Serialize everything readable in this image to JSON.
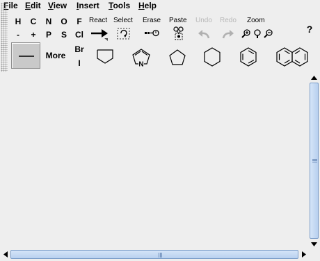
{
  "menu": [
    {
      "mnemonic": "F",
      "rest": "ile"
    },
    {
      "mnemonic": "E",
      "rest": "dit"
    },
    {
      "mnemonic": "V",
      "rest": "iew"
    },
    {
      "mnemonic": "I",
      "rest": "nsert"
    },
    {
      "mnemonic": "T",
      "rest": "ools"
    },
    {
      "mnemonic": "H",
      "rest": "elp"
    }
  ],
  "elements": {
    "row1": [
      "H",
      "C",
      "N",
      "O",
      "F"
    ],
    "row2": [
      "-",
      "+",
      "P",
      "S",
      "Cl"
    ],
    "extra": [
      "Br",
      "I"
    ]
  },
  "tools": {
    "react": "React",
    "select": "Select",
    "erase": "Erase",
    "paste": "Paste",
    "undo": "Undo",
    "redo": "Redo",
    "zoom": "Zoom",
    "help": "?"
  },
  "more_label": "More",
  "templates": [
    "cyclohexane-partial-icon",
    "pyrrole-icon",
    "cyclopentane-icon",
    "cyclohexane-icon",
    "benzene-icon",
    "naphthalene-icon"
  ],
  "pyrrole_atom": "N",
  "colors": {
    "background": "#eeeeee",
    "scroll_thumb": "#c6daf4",
    "disabled_text": "#b8b8b8"
  }
}
